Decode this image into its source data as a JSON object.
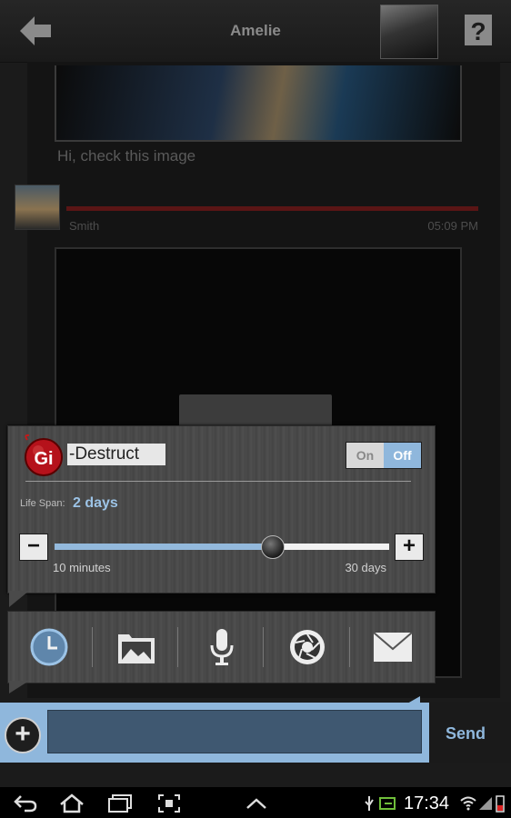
{
  "header": {
    "title": "Amelie"
  },
  "chat": {
    "message_text": "Hi, check this image",
    "sender_name": "Smith",
    "timestamp": "05:09 PM"
  },
  "self_destruct": {
    "badge": "Gi",
    "label": "-Destruct",
    "toggle_on": "On",
    "toggle_off": "Off",
    "toggle_state": "Off",
    "lifespan_label": "Life Span:",
    "lifespan_value": "2 days",
    "slider_min_label": "10 minutes",
    "slider_max_label": "30 days",
    "slider_fraction": 0.65,
    "minus": "−",
    "plus": "+"
  },
  "attachments": [
    "timer-icon",
    "gallery-icon",
    "microphone-icon",
    "camera-icon",
    "mail-icon"
  ],
  "composer": {
    "add": "+",
    "input_value": "",
    "input_placeholder": "",
    "send_label": "Send"
  },
  "status_bar": {
    "time": "17:34"
  },
  "colors": {
    "accent": "#8fb7dc",
    "panel": "#4a4a4a",
    "input": "#3f5871"
  }
}
